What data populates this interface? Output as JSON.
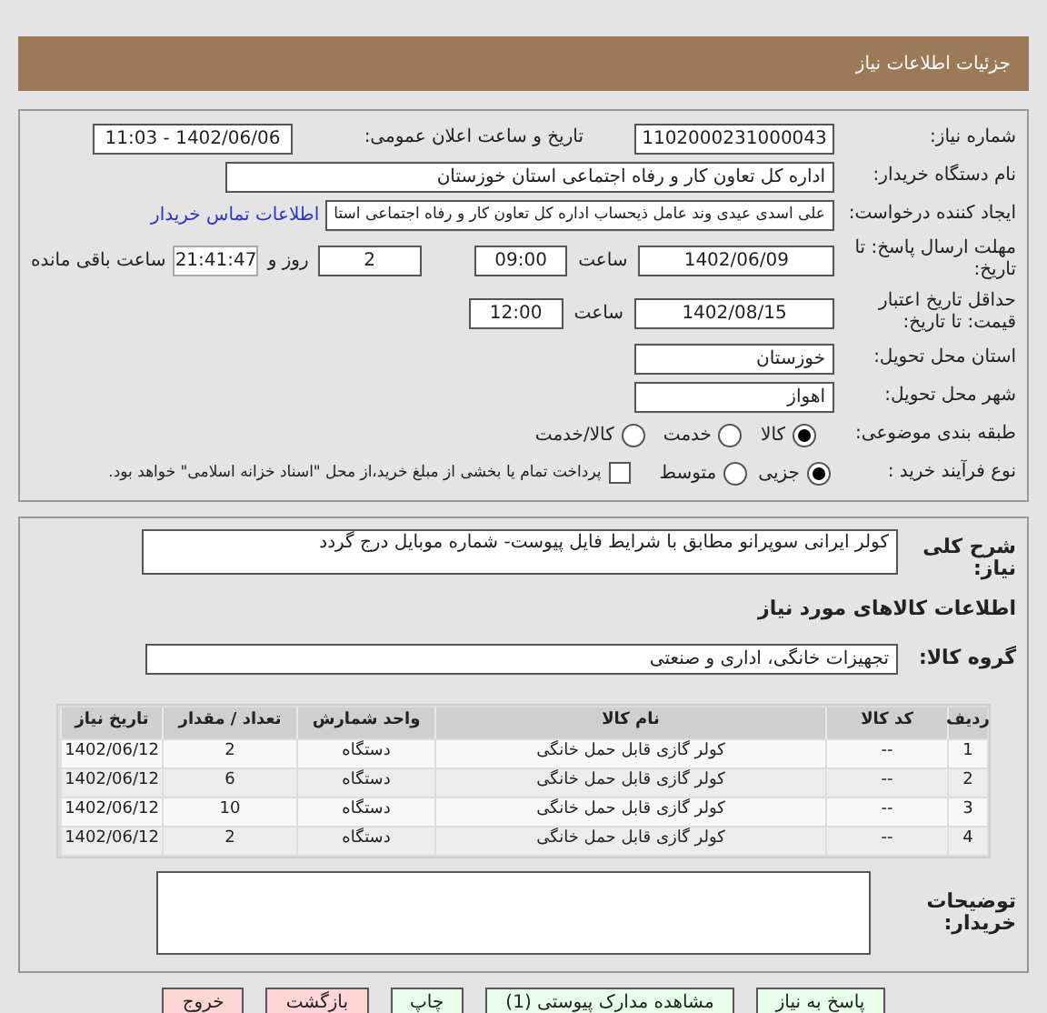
{
  "header": {
    "title": "جزئیات اطلاعات نیاز"
  },
  "need_number": {
    "label": "شماره نیاز:",
    "value": "1102000231000043"
  },
  "announce": {
    "label": "تاریخ و ساعت اعلان عمومی:",
    "value": "1402/06/06 - 11:03"
  },
  "buyer_org": {
    "label": "نام دستگاه خریدار:",
    "value": "اداره کل تعاون  کار و رفاه اجتماعی استان خوزستان"
  },
  "requester": {
    "label": "ایجاد کننده درخواست:",
    "value": "علی اسدی عیدی وند عامل ذیحساب اداره کل تعاون  کار و رفاه اجتماعی استا",
    "link": "اطلاعات تماس خریدار"
  },
  "deadline": {
    "label": "مهلت ارسال پاسخ: تا تاریخ:",
    "date": "1402/06/09",
    "time_label": "ساعت",
    "time": "09:00",
    "days": "2",
    "days_label": "روز و",
    "remaining": "21:41:47",
    "remaining_label": "ساعت باقی مانده"
  },
  "validity": {
    "label": "حداقل تاریخ اعتبار قیمت: تا تاریخ:",
    "date": "1402/08/15",
    "time_label": "ساعت",
    "time": "12:00"
  },
  "province": {
    "label": "استان محل تحویل:",
    "value": "خوزستان"
  },
  "city": {
    "label": "شهر محل تحویل:",
    "value": "اهواز"
  },
  "category": {
    "label": "طبقه بندی موضوعی:",
    "options": [
      {
        "label": "کالا",
        "selected": true
      },
      {
        "label": "خدمت",
        "selected": false
      },
      {
        "label": "کالا/خدمت",
        "selected": false
      }
    ]
  },
  "process": {
    "label": "نوع فرآیند خرید :",
    "options": [
      {
        "label": "جزیی",
        "selected": true
      },
      {
        "label": "متوسط",
        "selected": false
      }
    ],
    "treasury": {
      "label": "پرداخت تمام یا بخشی از مبلغ خرید،از محل \"اسناد خزانه اسلامی\" خواهد بود.",
      "checked": false
    }
  },
  "description": {
    "label": "شرح کلی نیاز:",
    "value": "کولر ایرانی سوپرانو مطابق با شرایط فایل پیوست- شماره موبایل درج گردد"
  },
  "goods_heading": "اطلاعات کالاهای مورد نیاز",
  "goods_group": {
    "label": "گروه کالا:",
    "value": "تجهیزات خانگی، اداری و صنعتی"
  },
  "table": {
    "columns": [
      "ردیف",
      "کد کالا",
      "نام کالا",
      "واحد شمارش",
      "تعداد / مقدار",
      "تاریخ نیاز"
    ],
    "rows": [
      [
        "1",
        "--",
        "کولر گازی قابل حمل خانگی",
        "دستگاه",
        "2",
        "1402/06/12"
      ],
      [
        "2",
        "--",
        "کولر گازی قابل حمل خانگی",
        "دستگاه",
        "6",
        "1402/06/12"
      ],
      [
        "3",
        "--",
        "کولر گازی قابل حمل خانگی",
        "دستگاه",
        "10",
        "1402/06/12"
      ],
      [
        "4",
        "--",
        "کولر گازی قابل حمل خانگی",
        "دستگاه",
        "2",
        "1402/06/12"
      ]
    ]
  },
  "buyer_notes": {
    "label": "توضیحات خریدار:"
  },
  "buttons": [
    {
      "label": "پاسخ به نیاز",
      "color": "#e8ffe8"
    },
    {
      "label": "مشاهده مدارک پیوستی (1)",
      "color": "#e8ffe8"
    },
    {
      "label": "چاپ",
      "color": "#e8ffe8"
    },
    {
      "label": "بازگشت",
      "color": "#ffd6d6"
    },
    {
      "label": "خروج",
      "color": "#ffd6d6"
    }
  ]
}
